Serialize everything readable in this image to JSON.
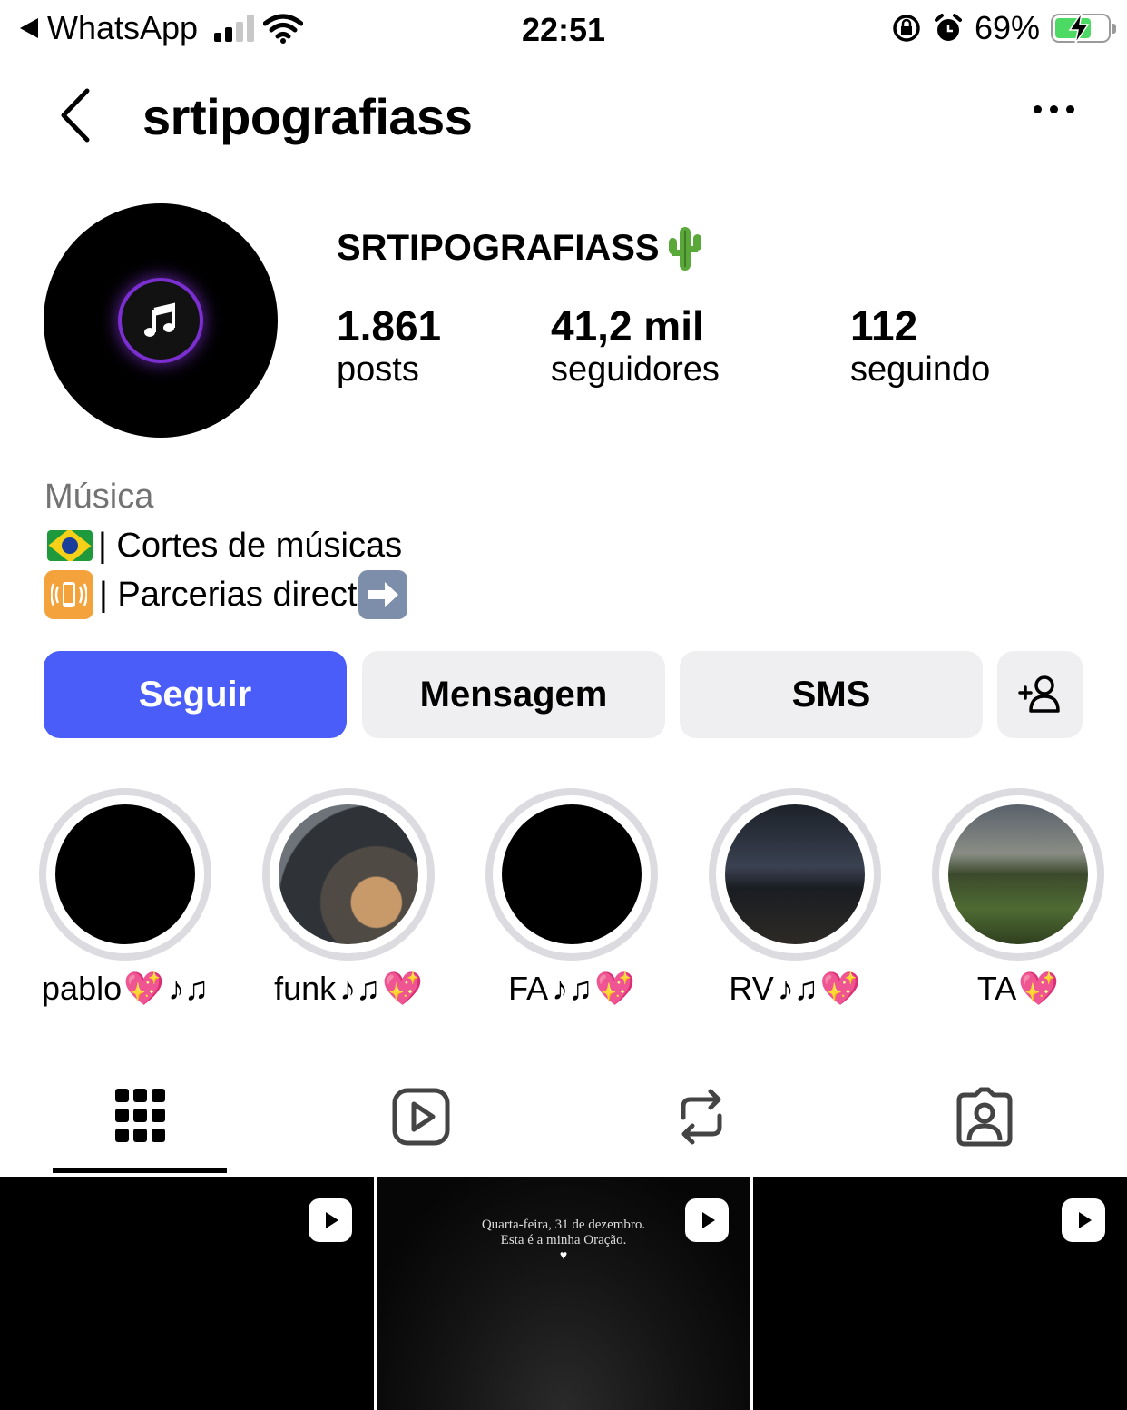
{
  "status_bar": {
    "back_app": "WhatsApp",
    "time": "22:51",
    "battery_text": "69%",
    "battery_level": 0.69
  },
  "header": {
    "username": "srtipografiass"
  },
  "profile": {
    "display_name": "SRTIPOGRAFIASS",
    "stats": [
      {
        "value": "1.861",
        "label": "posts"
      },
      {
        "value": "41,2 mil",
        "label": "seguidores"
      },
      {
        "value": "112",
        "label": "seguindo"
      }
    ],
    "category": "Música",
    "bio_lines": [
      "| Cortes de músicas",
      "| Parcerias direct"
    ]
  },
  "actions": {
    "follow": "Seguir",
    "message": "Mensagem",
    "sms": "SMS"
  },
  "highlights": [
    {
      "label": "pablo"
    },
    {
      "label": "funk"
    },
    {
      "label": "FA"
    },
    {
      "label": "RV"
    },
    {
      "label": "TA"
    }
  ],
  "tabs": [
    "grid-icon",
    "reels-icon",
    "reposts-icon",
    "tagged-icon"
  ],
  "posts": [
    {
      "type": "video",
      "text": ""
    },
    {
      "type": "video",
      "text_line1": "Quarta-feira, 31 de dezembro.",
      "text_line2": "Esta é a minha Oração."
    },
    {
      "type": "video",
      "text": ""
    }
  ],
  "colors": {
    "follow_button": "#4a5df9",
    "secondary_button": "#efeff1",
    "battery_fill": "#4cd964"
  }
}
